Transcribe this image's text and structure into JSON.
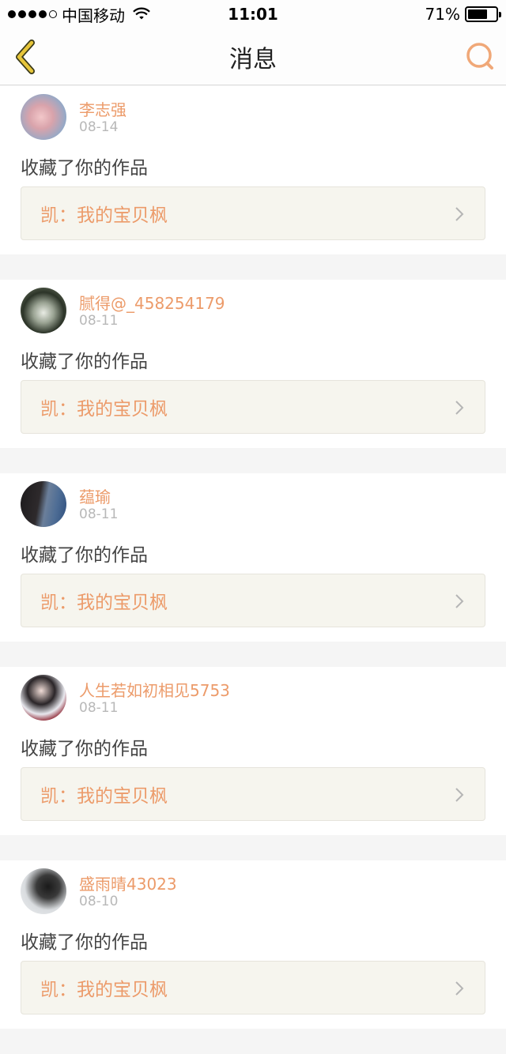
{
  "status_bar": {
    "carrier": "中国移动",
    "time": "11:01",
    "battery": "71%",
    "battery_level": 0.71
  },
  "nav": {
    "title": "消息",
    "back_icon": "back-chevron-icon",
    "search_icon": "search-icon"
  },
  "colors": {
    "accent": "#ec9b6a",
    "back_icon": "#e6c53a",
    "work_bg": "#f6f5ee"
  },
  "messages": [
    {
      "user": "李志强",
      "date": "08-14",
      "action": "收藏了你的作品",
      "work": "凯：我的宝贝枫"
    },
    {
      "user": "腻得@_458254179",
      "date": "08-11",
      "action": "收藏了你的作品",
      "work": "凯：我的宝贝枫"
    },
    {
      "user": "蕴瑜",
      "date": "08-11",
      "action": "收藏了你的作品",
      "work": "凯：我的宝贝枫"
    },
    {
      "user": "人生若如初相见5753",
      "date": "08-11",
      "action": "收藏了你的作品",
      "work": "凯：我的宝贝枫"
    },
    {
      "user": "盛雨晴43023",
      "date": "08-10",
      "action": "收藏了你的作品",
      "work": "凯：我的宝贝枫"
    }
  ]
}
